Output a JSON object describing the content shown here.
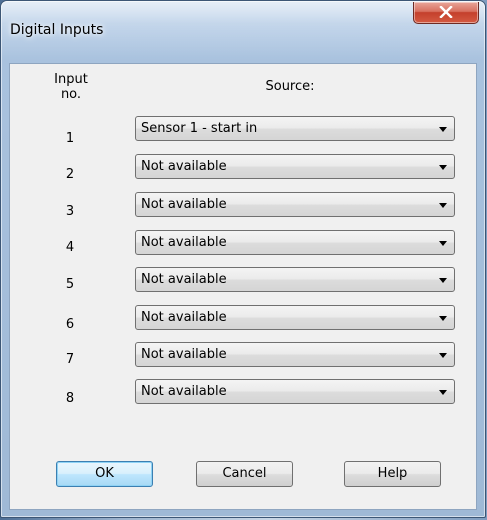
{
  "window": {
    "title": "Digital Inputs",
    "close_glyph": "close-icon"
  },
  "headers": {
    "input_no": "Input no.",
    "source": "Source:"
  },
  "rows": [
    {
      "no": "1",
      "value": "Sensor 1 - start in"
    },
    {
      "no": "2",
      "value": "Not available"
    },
    {
      "no": "3",
      "value": "Not available"
    },
    {
      "no": "4",
      "value": "Not available"
    },
    {
      "no": "5",
      "value": "Not available"
    },
    {
      "no": "6",
      "value": "Not available"
    },
    {
      "no": "7",
      "value": "Not available"
    },
    {
      "no": "8",
      "value": "Not available"
    }
  ],
  "buttons": {
    "ok": "OK",
    "cancel": "Cancel",
    "help": "Help"
  },
  "colors": {
    "frame": "#b7cde6",
    "client": "#f0f0f0",
    "close_button": "#c4402c",
    "default_button_border": "#3c7fb1"
  }
}
